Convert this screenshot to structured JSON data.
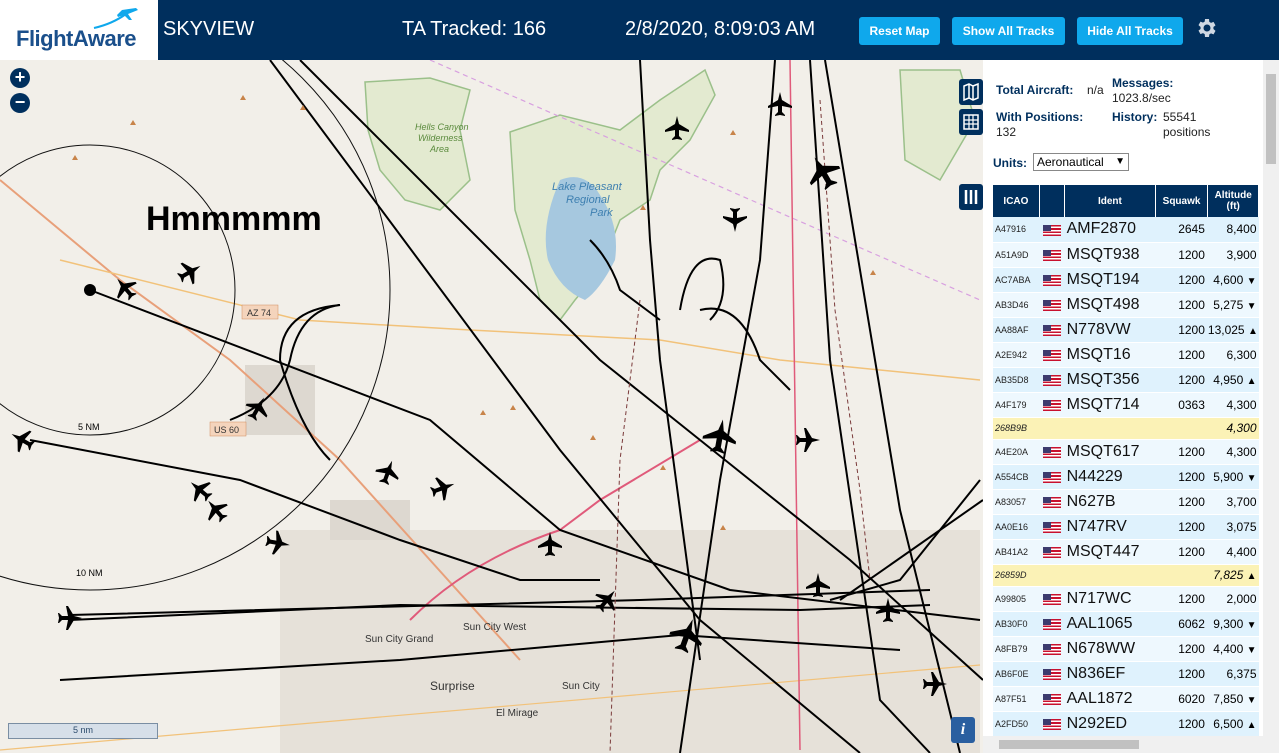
{
  "header": {
    "brand": "FlightAware",
    "site": "SKYVIEW",
    "tracked_label": "TA Tracked: 166",
    "datetime": "2/8/2020, 8:09:03 AM",
    "buttons": {
      "reset": "Reset Map",
      "show_all": "Show All Tracks",
      "hide_all": "Hide All Tracks"
    },
    "colors": {
      "bar": "#002f5d",
      "button": "#0fa8ec"
    }
  },
  "map": {
    "annotation": "Hmmmmm",
    "scale_label": "5 nm",
    "range_rings": [
      "5 NM",
      "10 NM"
    ],
    "places": [
      "Hells Canyon Wilderness Area",
      "Lake Pleasant Regional Park",
      "Sun City Grand",
      "Sun City West",
      "Surprise",
      "Sun City",
      "El Mirage"
    ],
    "roads": [
      "AZ 74",
      "US 60"
    ],
    "icons": [
      "zoom-in-icon",
      "zoom-out-icon",
      "map-layers-icon",
      "grid-icon",
      "columns-icon",
      "info-icon"
    ]
  },
  "stats": {
    "total_label": "Total Aircraft:",
    "total_value": "n/a",
    "messages_label": "Messages:",
    "messages_value": "1023.8/sec",
    "positions_label": "With Positions:",
    "positions_value": "132",
    "history_label": "History:",
    "history_value": "55541 positions",
    "units_label": "Units:",
    "units_value": "Aeronautical"
  },
  "table": {
    "headers": {
      "icao": "ICAO",
      "ident": "Ident",
      "squawk": "Squawk",
      "altitude": "Altitude (ft)"
    },
    "rows": [
      {
        "icao": "A47916",
        "ident": "AMF2870",
        "squawk": "2645",
        "alt": "8,400",
        "trend": ""
      },
      {
        "icao": "A51A9D",
        "ident": "MSQT938",
        "squawk": "1200",
        "alt": "3,900",
        "trend": ""
      },
      {
        "icao": "AC7ABA",
        "ident": "MSQT194",
        "squawk": "1200",
        "alt": "4,600",
        "trend": "▼"
      },
      {
        "icao": "AB3D46",
        "ident": "MSQT498",
        "squawk": "1200",
        "alt": "5,275",
        "trend": "▼"
      },
      {
        "icao": "AA88AF",
        "ident": "N778VW",
        "squawk": "1200",
        "alt": "13,025",
        "trend": "▲"
      },
      {
        "icao": "A2E942",
        "ident": "MSQT16",
        "squawk": "1200",
        "alt": "6,300",
        "trend": ""
      },
      {
        "icao": "AB35D8",
        "ident": "MSQT356",
        "squawk": "1200",
        "alt": "4,950",
        "trend": "▲"
      },
      {
        "icao": "A4F179",
        "ident": "MSQT714",
        "squawk": "0363",
        "alt": "4,300",
        "trend": ""
      },
      {
        "icao": "268B9B",
        "ident": "",
        "squawk": "",
        "alt": "4,300",
        "trend": "",
        "nopos": true
      },
      {
        "icao": "A4E20A",
        "ident": "MSQT617",
        "squawk": "1200",
        "alt": "4,300",
        "trend": ""
      },
      {
        "icao": "A554CB",
        "ident": "N44229",
        "squawk": "1200",
        "alt": "5,900",
        "trend": "▼"
      },
      {
        "icao": "A83057",
        "ident": "N627B",
        "squawk": "1200",
        "alt": "3,700",
        "trend": ""
      },
      {
        "icao": "AA0E16",
        "ident": "N747RV",
        "squawk": "1200",
        "alt": "3,075",
        "trend": ""
      },
      {
        "icao": "AB41A2",
        "ident": "MSQT447",
        "squawk": "1200",
        "alt": "4,400",
        "trend": ""
      },
      {
        "icao": "26859D",
        "ident": "",
        "squawk": "",
        "alt": "7,825",
        "trend": "▲",
        "nopos": true
      },
      {
        "icao": "A99805",
        "ident": "N717WC",
        "squawk": "1200",
        "alt": "2,000",
        "trend": ""
      },
      {
        "icao": "AB30F0",
        "ident": "AAL1065",
        "squawk": "6062",
        "alt": "9,300",
        "trend": "▼"
      },
      {
        "icao": "A8FB79",
        "ident": "N678WW",
        "squawk": "1200",
        "alt": "4,400",
        "trend": "▼"
      },
      {
        "icao": "AB6F0E",
        "ident": "N836EF",
        "squawk": "1200",
        "alt": "6,375",
        "trend": ""
      },
      {
        "icao": "A87F51",
        "ident": "AAL1872",
        "squawk": "6020",
        "alt": "7,850",
        "trend": "▼"
      },
      {
        "icao": "A2FD50",
        "ident": "N292ED",
        "squawk": "1200",
        "alt": "6,500",
        "trend": "▲"
      }
    ]
  }
}
